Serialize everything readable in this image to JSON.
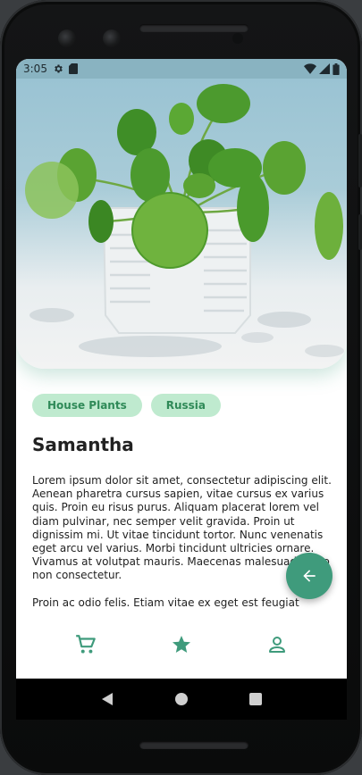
{
  "status_bar": {
    "time": "3:05"
  },
  "tags": [
    {
      "label": "House Plants"
    },
    {
      "label": "Russia"
    }
  ],
  "plant": {
    "name": "Samantha",
    "description": [
      "Lorem ipsum dolor sit amet, consectetur adipiscing elit. Aenean pharetra cursus sapien, vitae cursus ex varius quis. Proin eu risus purus. Aliquam placerat lorem vel diam pulvinar, nec semper velit gravida. Proin ut dignissim mi. Ut vitae tincidunt tortor. Nunc venenatis eget arcu vel varius. Morbi tincidunt ultricies ornare. Vivamus at volutpat mauris. Maecenas malesuada odio non consectetur.",
      "Proin ac odio felis. Etiam vitae ex eget est feugiat"
    ]
  },
  "bottom_nav": {
    "items": [
      "cart-icon",
      "star-icon",
      "account-icon"
    ]
  },
  "colors": {
    "accent": "#3f9b7c",
    "chip_bg": "#bfeacf",
    "chip_text": "#2f8a58",
    "status_bar": "#89b3c1"
  }
}
